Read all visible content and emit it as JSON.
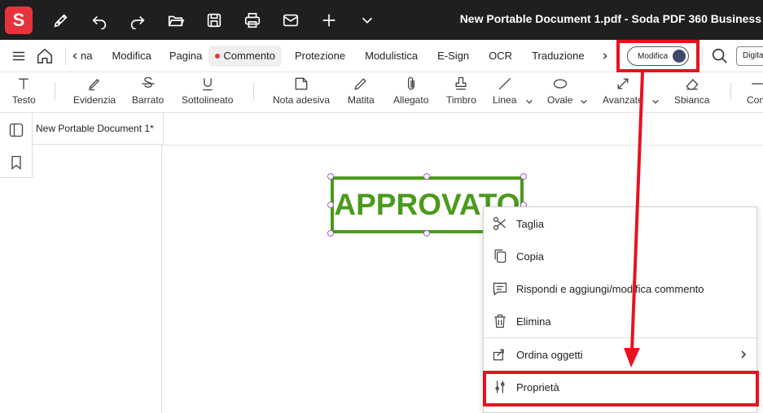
{
  "titlebar": {
    "logo_letter": "S",
    "title": "New Portable Document 1.pdf  -  Soda PDF 360 Business",
    "icons": [
      "pen-icon",
      "undo-icon",
      "redo-icon",
      "folder-open-icon",
      "save-icon",
      "print-icon",
      "mail-icon",
      "plus-icon",
      "chevron-down-icon"
    ]
  },
  "menubar": {
    "tabs": [
      {
        "label": "na"
      },
      {
        "label": "Modifica"
      },
      {
        "label": "Pagina"
      },
      {
        "label": "Commento"
      },
      {
        "label": "Protezione"
      },
      {
        "label": "Modulistica"
      },
      {
        "label": "E-Sign"
      },
      {
        "label": "OCR"
      },
      {
        "label": "Traduzione"
      }
    ],
    "active_tab": "Commento",
    "toggle_label": "Modifica",
    "digit_label": "Digita"
  },
  "toolbar": {
    "tools": [
      {
        "label": "Testo",
        "icon": "text-icon"
      },
      {
        "label": "Evidenzia",
        "icon": "highlight-icon"
      },
      {
        "label": "Barrato",
        "icon": "strikethrough-icon"
      },
      {
        "label": "Sottolineato",
        "icon": "underline-icon"
      },
      {
        "label": "Nota adesiva",
        "icon": "sticky-note-icon"
      },
      {
        "label": "Matita",
        "icon": "pencil-icon"
      },
      {
        "label": "Allegato",
        "icon": "paperclip-icon"
      },
      {
        "label": "Timbro",
        "icon": "stamp-icon"
      },
      {
        "label": "Linea",
        "icon": "line-icon"
      },
      {
        "label": "Ovale",
        "icon": "oval-icon"
      },
      {
        "label": "Avanzate",
        "icon": "resize-icon"
      },
      {
        "label": "Sbianca",
        "icon": "eraser-icon"
      },
      {
        "label": "Com",
        "icon": "comment-icon"
      }
    ]
  },
  "document": {
    "tab_label": "New Portable Document 1*",
    "stamp_text": "APPROVATO"
  },
  "context_menu": {
    "items": [
      {
        "label": "Taglia",
        "icon": "scissors-icon"
      },
      {
        "label": "Copia",
        "icon": "copy-icon"
      },
      {
        "label": "Rispondi e aggiungi/modifica commento",
        "icon": "comment-edit-icon"
      },
      {
        "label": "Elimina",
        "icon": "trash-icon"
      },
      {
        "label": "Ordina oggetti",
        "icon": "arrange-icon"
      },
      {
        "label": "Proprietà",
        "icon": "sliders-icon"
      }
    ]
  },
  "colors": {
    "titlebar_bg": "#1f1f1f",
    "logo_red": "#e8333d",
    "stamp_green": "#4a9a1c",
    "annotation_red": "#e8121f"
  }
}
